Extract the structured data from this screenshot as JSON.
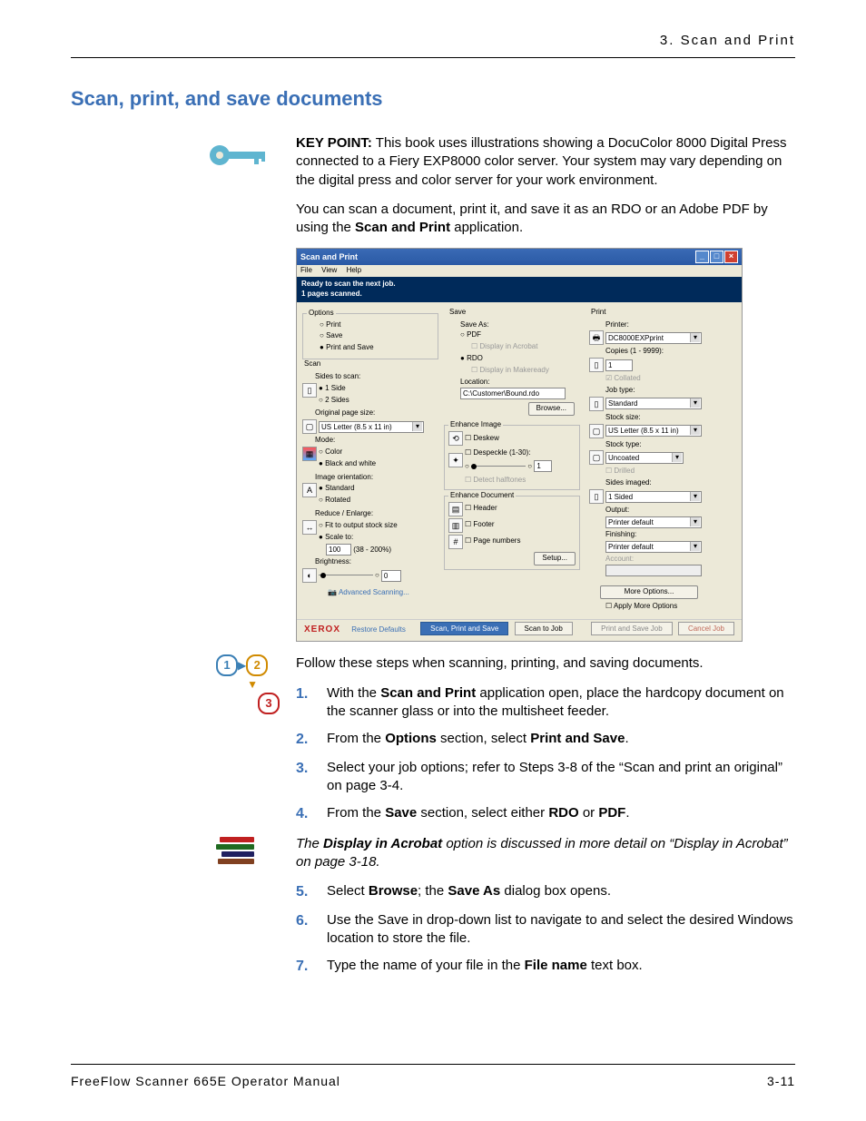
{
  "header": {
    "chapter": "3. Scan and Print"
  },
  "section_title": "Scan, print, and save documents",
  "keypoint": {
    "label": "KEY POINT:",
    "text": " This book uses illustrations showing a DocuColor 8000 Digital Press connected to a Fiery EXP8000 color server.  Your system may vary depending on the digital press and color server for your work environment."
  },
  "intro_para": {
    "pre": "You can scan a document, print it, and save it as an RDO or an Adobe PDF by using the ",
    "bold": "Scan and Print",
    "post": " application."
  },
  "screenshot": {
    "title": "Scan and Print",
    "menus": [
      "File",
      "View",
      "Help"
    ],
    "status_line1": "Ready to scan the next job.",
    "status_line2": "1 pages scanned.",
    "options": {
      "legend": "Options",
      "print": "Print",
      "save": "Save",
      "print_and_save": "Print and Save"
    },
    "scan": {
      "legend": "Scan",
      "sides_label": "Sides to scan:",
      "one_side": "1 Side",
      "two_sides": "2 Sides",
      "orig_size_label": "Original page size:",
      "orig_size_value": "US Letter (8.5 x 11 in)",
      "mode_label": "Mode:",
      "mode_color": "Color",
      "mode_bw": "Black and white",
      "orient_label": "Image orientation:",
      "orient_std": "Standard",
      "orient_rot": "Rotated",
      "reduce_label": "Reduce / Enlarge:",
      "fit": "Fit to output stock size",
      "scale": "Scale to:",
      "scale_value": "100",
      "scale_range": "(38 - 200%)",
      "brightness_label": "Brightness:",
      "brightness_value": "0",
      "adv_scan": "Advanced Scanning..."
    },
    "save": {
      "legend": "Save",
      "save_as": "Save As:",
      "pdf": "PDF",
      "disp_acro": "Display in Acrobat",
      "rdo": "RDO",
      "disp_mm": "Display in Makeready",
      "location": "Location:",
      "location_value": "C:\\Customer\\Bound.rdo",
      "browse": "Browse..."
    },
    "enhance_image": {
      "legend": "Enhance Image",
      "deskew": "Deskew",
      "despeckle": "Despeckle (1-30):",
      "despeckle_val": "1",
      "detect": "Detect halftones"
    },
    "enhance_doc": {
      "legend": "Enhance Document",
      "header": "Header",
      "footer": "Footer",
      "page_numbers": "Page numbers",
      "setup": "Setup..."
    },
    "print": {
      "legend": "Print",
      "printer_label": "Printer:",
      "printer_value": "DC8000EXPprint",
      "copies_label": "Copies (1 - 9999):",
      "copies_value": "1",
      "collated": "Collated",
      "job_type_label": "Job type:",
      "job_type_value": "Standard",
      "stock_size_label": "Stock size:",
      "stock_size_value": "US Letter (8.5 x 11 in)",
      "stock_type_label": "Stock type:",
      "stock_type_value": "Uncoated",
      "drilled": "Drilled",
      "sides_imaged_label": "Sides imaged:",
      "sides_imaged_value": "1 Sided",
      "output_label": "Output:",
      "output_value": "Printer default",
      "finishing_label": "Finishing:",
      "finishing_value": "Printer default",
      "account": "Account:",
      "more_options": "More Options...",
      "apply_more": "Apply More Options"
    },
    "footer": {
      "brand": "XEROX",
      "restore": "Restore Defaults",
      "primary": "Scan, Print and Save",
      "scan_to_job": "Scan to Job",
      "print_save_job": "Print and Save Job",
      "cancel": "Cancel Job"
    }
  },
  "follow_text": "Follow these steps when scanning, printing, and saving documents.",
  "steps": [
    {
      "n": "1.",
      "pre": "With the ",
      "b1": "Scan and Print",
      "post": " application open, place the hardcopy document on the scanner glass or into the multisheet feeder."
    },
    {
      "n": "2.",
      "pre": "From the ",
      "b1": "Options",
      "mid": " section, select ",
      "b2": "Print and Save",
      "post": "."
    },
    {
      "n": "3.",
      "pre": "Select your job options; refer to Steps 3-8 of the “Scan and print an original” on page 3-4."
    },
    {
      "n": "4.",
      "pre": "From the ",
      "b1": "Save",
      "mid": " section, select either ",
      "b2": "RDO",
      "mid2": " or ",
      "b3": "PDF",
      "post": "."
    }
  ],
  "note": {
    "pre": "The ",
    "bold": "Display in Acrobat",
    "post": " option is discussed in more detail on “Display in Acrobat” on page 3-18."
  },
  "steps2": [
    {
      "n": "5.",
      "pre": "Select ",
      "b1": "Browse",
      "mid": "; the ",
      "b2": "Save As",
      "post": " dialog box opens."
    },
    {
      "n": "6.",
      "pre": "Use the Save in drop-down list to navigate to and select the desired Windows location to store the file."
    },
    {
      "n": "7.",
      "pre": "Type the name of your file in the ",
      "b1": "File name",
      "post": " text box."
    }
  ],
  "footer": {
    "manual": "FreeFlow Scanner 665E Operator Manual",
    "page": "3-11"
  }
}
